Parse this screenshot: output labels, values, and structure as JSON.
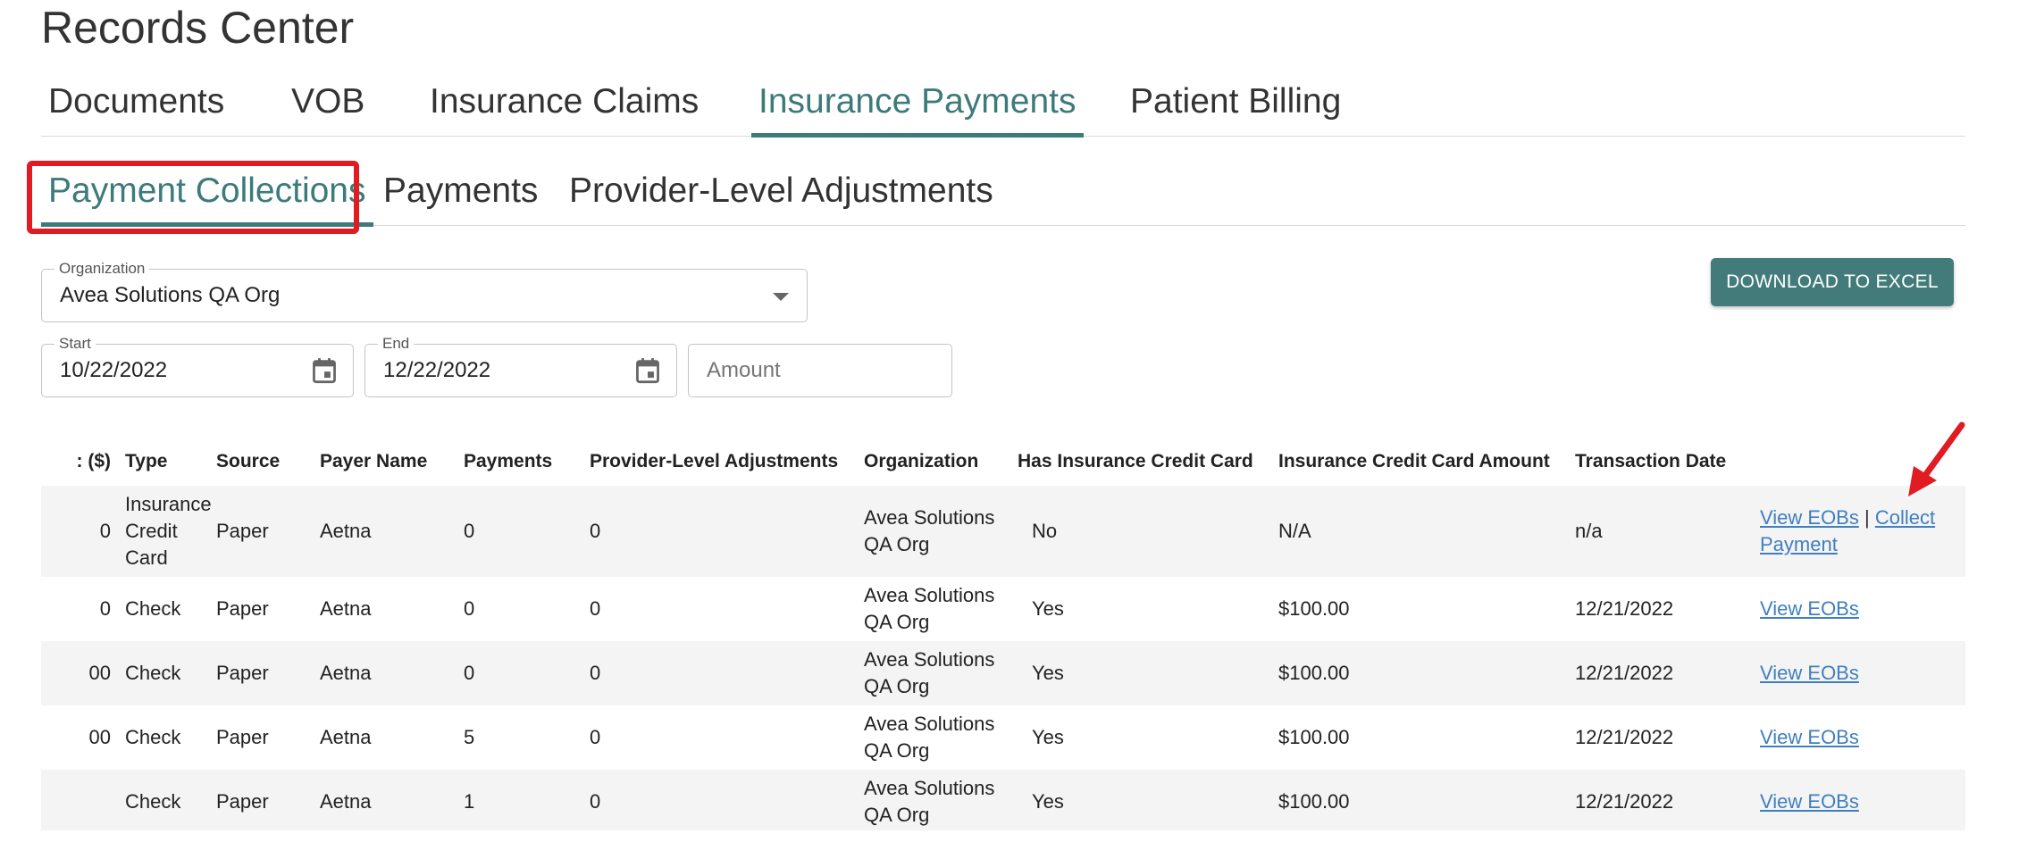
{
  "page_title": "Records Center",
  "main_tabs": [
    {
      "label": "Documents"
    },
    {
      "label": "VOB"
    },
    {
      "label": "Insurance Claims"
    },
    {
      "label": "Insurance Payments",
      "active": true
    },
    {
      "label": "Patient Billing"
    }
  ],
  "sub_tabs": [
    {
      "label": "Payment Collections",
      "active": true
    },
    {
      "label": "Payments"
    },
    {
      "label": "Provider-Level Adjustments"
    }
  ],
  "filters": {
    "organization_label": "Organization",
    "organization_value": "Avea Solutions QA Org",
    "start_label": "Start",
    "start_value": "10/22/2022",
    "end_label": "End",
    "end_value": "12/22/2022",
    "amount_placeholder": "Amount"
  },
  "download_button": "DOWNLOAD TO EXCEL",
  "table": {
    "headers": [
      ": ($)",
      "Type",
      "Source",
      "Payer Name",
      "Payments",
      "Provider-Level Adjustments",
      "Organization",
      "Has Insurance Credit Card",
      "Insurance Credit Card Amount",
      "Transaction Date",
      ""
    ],
    "rows": [
      {
        "amount": "0",
        "type": "Insurance Credit Card",
        "source": "Paper",
        "payer": "Aetna",
        "payments": "0",
        "adjustments": "0",
        "organization": "Avea Solutions QA Org",
        "has_card": "No",
        "card_amount": "N/A",
        "date": "n/a",
        "view_eobs": "View EOBs",
        "separator": "|",
        "collect_payment": "Collect Payment"
      },
      {
        "amount": "0",
        "type": "Check",
        "source": "Paper",
        "payer": "Aetna",
        "payments": "0",
        "adjustments": "0",
        "organization": "Avea Solutions QA Org",
        "has_card": "Yes",
        "card_amount": "$100.00",
        "date": "12/21/2022",
        "view_eobs": "View EOBs"
      },
      {
        "amount": "00",
        "type": "Check",
        "source": "Paper",
        "payer": "Aetna",
        "payments": "0",
        "adjustments": "0",
        "organization": "Avea Solutions QA Org",
        "has_card": "Yes",
        "card_amount": "$100.00",
        "date": "12/21/2022",
        "view_eobs": "View EOBs"
      },
      {
        "amount": "00",
        "type": "Check",
        "source": "Paper",
        "payer": "Aetna",
        "payments": "5",
        "adjustments": "0",
        "organization": "Avea Solutions QA Org",
        "has_card": "Yes",
        "card_amount": "$100.00",
        "date": "12/21/2022",
        "view_eobs": "View EOBs"
      },
      {
        "amount": "",
        "type": "Check",
        "source": "Paper",
        "payer": "Aetna",
        "payments": "1",
        "adjustments": "0",
        "organization": "Avea Solutions QA Org",
        "has_card": "Yes",
        "card_amount": "$100.00",
        "date": "12/21/2022",
        "view_eobs": "View EOBs"
      }
    ]
  },
  "colors": {
    "accent": "#3d7a7a",
    "highlight": "#e11b22",
    "link": "#3f7fc1"
  }
}
